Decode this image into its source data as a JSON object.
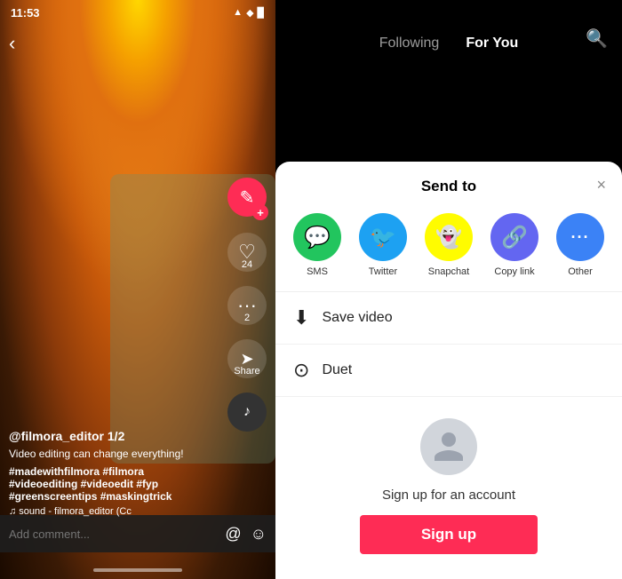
{
  "phone": {
    "status_time": "11:53",
    "status_icons": "▲ ◆ ▉",
    "username": "@filmora_editor  1/2",
    "description": "Video editing can change everything!",
    "hashtags": "#madewithfilmora #filmora\n#videoediting #videoedit #fyp\n#greenscreentips #maskingtrick",
    "music": "♫ sound - filmora_editor (Cc",
    "comment_placeholder": "Add comment...",
    "heart_count": "24",
    "dots_count": "2",
    "share_label": "Share"
  },
  "nav": {
    "following_label": "Following",
    "for_you_label": "For You",
    "active_tab": "for_you"
  },
  "sheet": {
    "title": "Send to",
    "close_label": "×",
    "share_items": [
      {
        "id": "sms",
        "label": "SMS",
        "icon": "💬",
        "style": "sms"
      },
      {
        "id": "twitter",
        "label": "Twitter",
        "icon": "🐦",
        "style": "twitter"
      },
      {
        "id": "snapchat",
        "label": "Snapchat",
        "icon": "👻",
        "style": "snapchat"
      },
      {
        "id": "copylink",
        "label": "Copy link",
        "icon": "🔗",
        "style": "copylink"
      },
      {
        "id": "other",
        "label": "Other",
        "icon": "•••",
        "style": "other"
      }
    ],
    "save_video_label": "Save video",
    "duet_label": "Duet",
    "signup_prompt": "Sign up for an account",
    "signup_button": "Sign up"
  }
}
